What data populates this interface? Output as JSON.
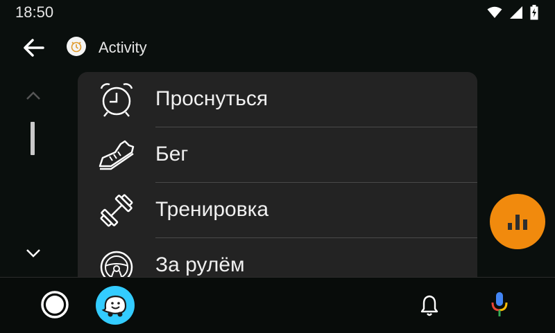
{
  "status_bar": {
    "time": "18:50",
    "icons": [
      "wifi-icon",
      "cellular-signal-icon",
      "battery-charging-icon"
    ]
  },
  "app_bar": {
    "back_icon": "arrow-back-icon",
    "app_icon": "alarm-clock-app-icon",
    "title": "Activity"
  },
  "scroll": {
    "up_icon": "chevron-up-icon",
    "down_icon": "chevron-down-icon"
  },
  "activities": [
    {
      "label": "Проснуться",
      "icon": "alarm-clock-icon"
    },
    {
      "label": "Бег",
      "icon": "running-shoe-icon"
    },
    {
      "label": "Тренировка",
      "icon": "dumbbell-icon"
    },
    {
      "label": "За рулём",
      "icon": "steering-wheel-icon"
    }
  ],
  "fab": {
    "icon": "bar-chart-icon",
    "color": "#f18a0d"
  },
  "bottom_bar": {
    "home_icon": "home-circle-icon",
    "waze_icon": "waze-icon",
    "notifications_icon": "bell-icon",
    "mic_icon": "microphone-icon"
  },
  "colors": {
    "background": "#0a0f0d",
    "card": "#232323",
    "accent": "#f18a0d",
    "waze": "#33ccff"
  }
}
